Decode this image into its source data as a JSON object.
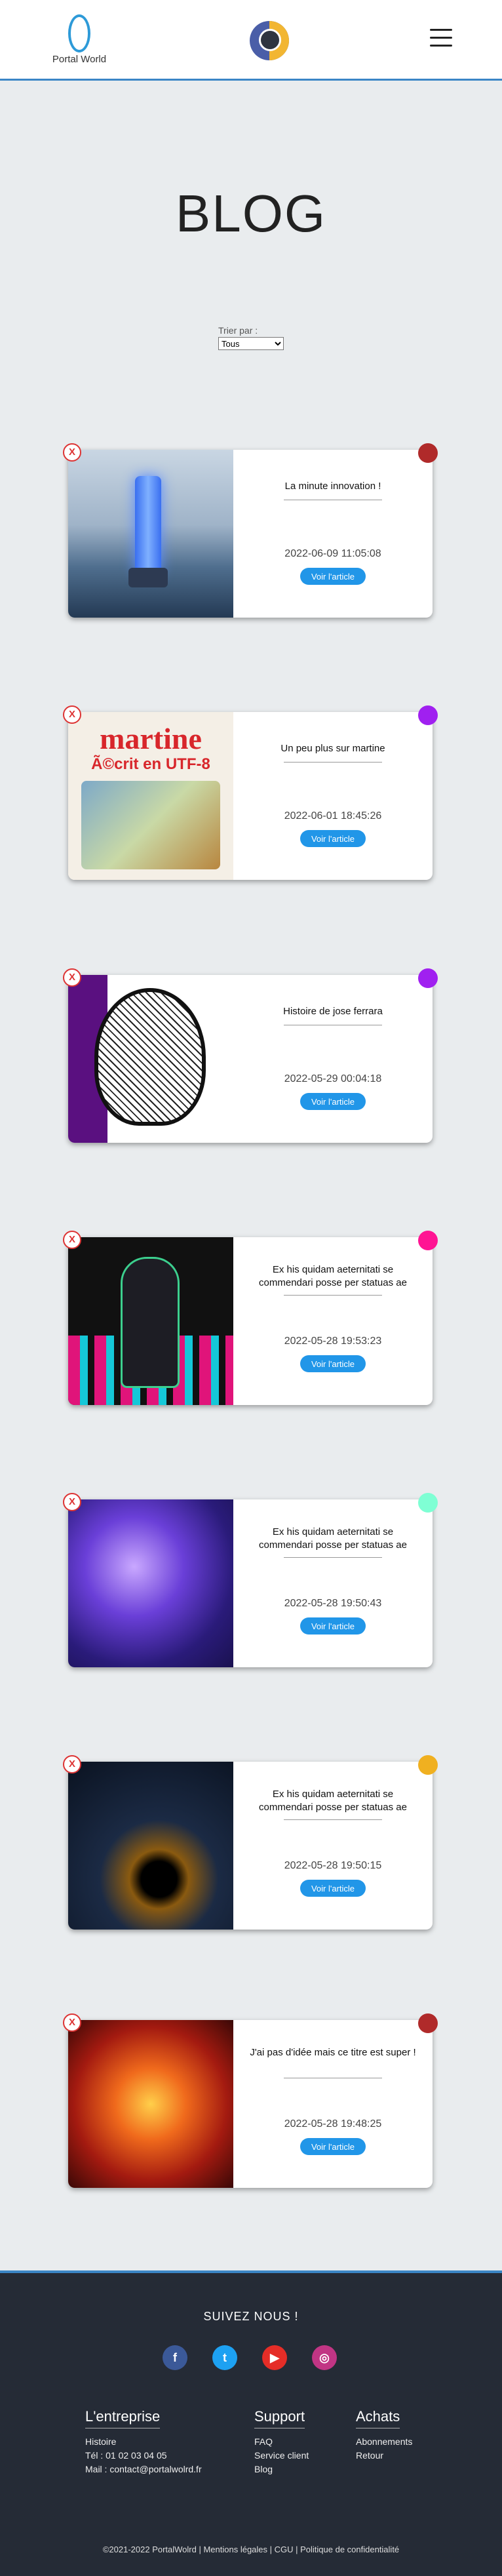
{
  "header": {
    "logo_text": "Portal World"
  },
  "page": {
    "title": "BLOG",
    "sort_label": "Trier par :",
    "sort_selected": "Tous"
  },
  "colors": {
    "accent": "#2196e8",
    "header_border": "#3b86c6",
    "footer_bg": "#252b36"
  },
  "articles": [
    {
      "title": "La minute innovation !",
      "date": "2022-06-09 11:05:08",
      "button": "Voir l'article",
      "delete": "X",
      "dot_color": "#b02a2a",
      "image": "robot-uv-lamp"
    },
    {
      "title": "Un peu plus sur martine",
      "date": "2022-06-01 18:45:26",
      "button": "Voir l'article",
      "delete": "X",
      "dot_color": "#a020f0",
      "image": "martine-cover",
      "image_text": "martine",
      "image_subtext": "Ã©crit en UTF-8"
    },
    {
      "title": "Histoire de jose ferrara",
      "date": "2022-05-29 00:04:18",
      "button": "Voir l'article",
      "delete": "X",
      "dot_color": "#a020f0",
      "image": "sketch-face"
    },
    {
      "title": "Ex his quidam aeternitati se commendari posse per statuas ae",
      "date": "2022-05-28 19:53:23",
      "button": "Voir l'article",
      "delete": "X",
      "dot_color": "#ff1493",
      "image": "anime-character"
    },
    {
      "title": "Ex his quidam aeternitati se commendari posse per statuas ae",
      "date": "2022-05-28 19:50:43",
      "button": "Voir l'article",
      "delete": "X",
      "dot_color": "#7fffd4",
      "image": "purple-abstract"
    },
    {
      "title": "Ex his quidam aeternitati se commendari posse per statuas ae",
      "date": "2022-05-28 19:50:15",
      "button": "Voir l'article",
      "delete": "X",
      "dot_color": "#f0b020",
      "image": "fractal"
    },
    {
      "title": "J'ai pas d'idée mais ce titre est super !",
      "date": "2022-05-28 19:48:25",
      "button": "Voir l'article",
      "delete": "X",
      "dot_color": "#b02a2a",
      "image": "fire-dragon"
    }
  ],
  "footer": {
    "follow": "SUIVEZ NOUS !",
    "socials": [
      {
        "name": "facebook-icon",
        "glyph": "f",
        "color": "#3b5998"
      },
      {
        "name": "twitter-icon",
        "glyph": "t",
        "color": "#1da1f2"
      },
      {
        "name": "youtube-icon",
        "glyph": "▶",
        "color": "#e52d27"
      },
      {
        "name": "instagram-icon",
        "glyph": "◎",
        "color": "#c13584"
      }
    ],
    "columns": [
      {
        "title": "L'entreprise",
        "items": [
          "Histoire",
          "Tél : 01 02 03 04 05",
          "Mail : contact@portalwolrd.fr"
        ]
      },
      {
        "title": "Support",
        "items": [
          "FAQ",
          "Service client",
          "Blog"
        ]
      },
      {
        "title": "Achats",
        "items": [
          "Abonnements",
          "Retour"
        ]
      }
    ],
    "copyright": "©2021-2022 PortalWolrd | Mentions légales | CGU | Politique de confidentialité"
  }
}
